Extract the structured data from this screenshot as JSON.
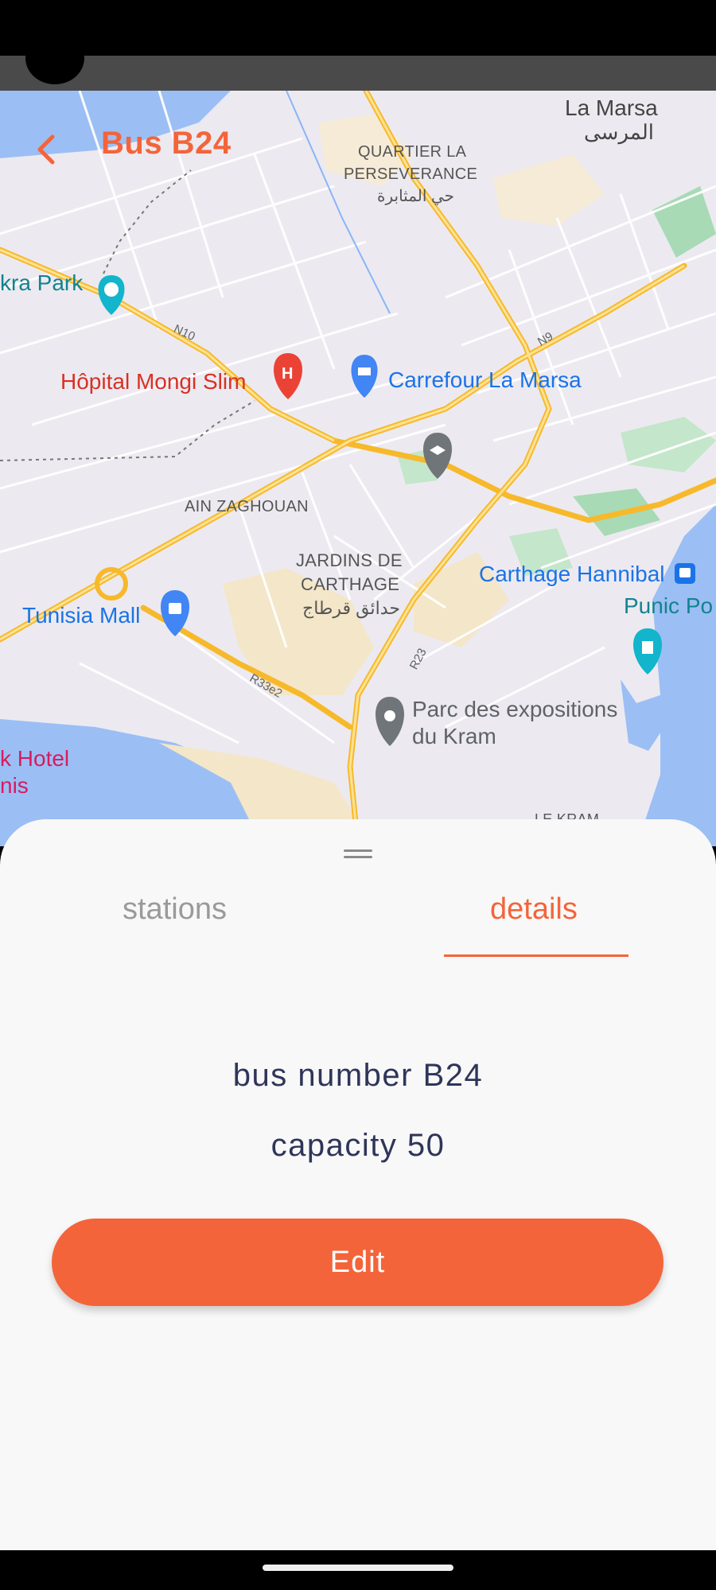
{
  "header": {
    "title": "Bus B24"
  },
  "map": {
    "labels": {
      "la_marsa": "La Marsa",
      "la_marsa_ar": "المرسى",
      "quartier_1": "QUARTIER LA",
      "quartier_2": "PERSEVERANCE",
      "quartier_ar": "حي المثابرة",
      "park": "kra Park",
      "hopital": "Hôpital Mongi Slim",
      "carrefour": "Carrefour La Marsa",
      "ain_zaghouan": "AIN ZAGHOUAN",
      "jardins_1": "JARDINS DE",
      "jardins_2": "CARTHAGE",
      "jardins_ar": "حدائق قرطاج",
      "carthage_hannibal": "Carthage Hannibal",
      "punic_port": "Punic Po",
      "tunisia_mall": "Tunisia Mall",
      "parc_1": "Parc des expositions",
      "parc_2": "du Kram",
      "hotel_1": "k Hotel",
      "hotel_2": "nis",
      "le_kram": "LE KRAM"
    },
    "roads": {
      "n10": "N10",
      "n9": "N9",
      "r23": "R23",
      "r33e2": "R33e2"
    }
  },
  "sheet": {
    "tabs": [
      {
        "label": "stations",
        "active": false
      },
      {
        "label": "details",
        "active": true
      }
    ],
    "bus_number": "bus number B24",
    "capacity": "capacity 50",
    "edit_label": "Edit"
  },
  "colors": {
    "accent": "#f4643a",
    "text_dark": "#2f3559",
    "tab_inactive": "#9a9a9a",
    "sheet_bg": "#f8f8f8"
  }
}
